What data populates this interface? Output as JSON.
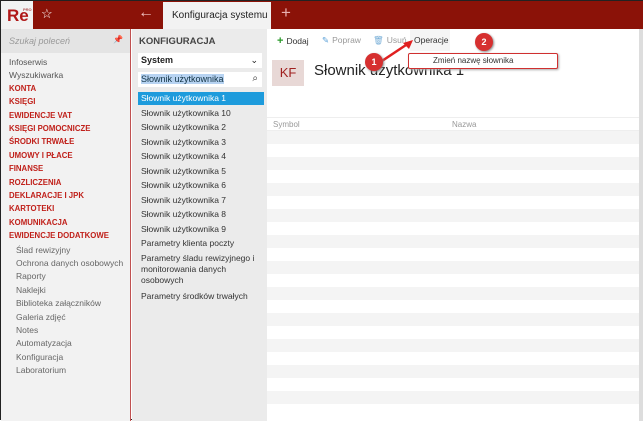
{
  "app": {
    "logo": "Re",
    "logo_sup": "PRO",
    "tab": "Konfiguracja systemu"
  },
  "sidebar": {
    "search_placeholder": "Szukaj poleceń",
    "items": [
      {
        "label": "Infoserwis",
        "type": "plain"
      },
      {
        "label": "Wyszukiwarka",
        "type": "plain"
      },
      {
        "label": "KONTA",
        "type": "cat"
      },
      {
        "label": "KSIĘGI",
        "type": "cat"
      },
      {
        "label": "EWIDENCJE VAT",
        "type": "cat"
      },
      {
        "label": "KSIĘGI POMOCNICZE",
        "type": "cat"
      },
      {
        "label": "ŚRODKI TRWAŁE",
        "type": "cat"
      },
      {
        "label": "UMOWY I PŁACE",
        "type": "cat"
      },
      {
        "label": "FINANSE",
        "type": "cat"
      },
      {
        "label": "ROZLICZENIA",
        "type": "cat"
      },
      {
        "label": "DEKLARACJE I JPK",
        "type": "cat"
      },
      {
        "label": "KARTOTEKI",
        "type": "cat"
      },
      {
        "label": "KOMUNIKACJA",
        "type": "cat"
      },
      {
        "label": "EWIDENCJE DODATKOWE",
        "type": "cat"
      },
      {
        "label": "Ślad rewizyjny",
        "type": "sub"
      },
      {
        "label": "Ochrona danych osobowych",
        "type": "sub"
      },
      {
        "label": "Raporty",
        "type": "sub"
      },
      {
        "label": "Naklejki",
        "type": "sub"
      },
      {
        "label": "Biblioteka załączników",
        "type": "sub"
      },
      {
        "label": "Galeria zdjęć",
        "type": "sub"
      },
      {
        "label": "Notes",
        "type": "sub"
      },
      {
        "label": "Automatyzacja",
        "type": "sub"
      },
      {
        "label": "Konfiguracja",
        "type": "sub"
      },
      {
        "label": "Laboratorium",
        "type": "sub"
      }
    ]
  },
  "middle": {
    "heading": "KONFIGURACJA",
    "select": "System",
    "search_value": "Słownik użytkownika",
    "items": [
      "Słownik użytkownika 1",
      "Słownik użytkownika 10",
      "Słownik użytkownika 2",
      "Słownik użytkownika 3",
      "Słownik użytkownika 4",
      "Słownik użytkownika 5",
      "Słownik użytkownika 6",
      "Słownik użytkownika 7",
      "Słownik użytkownika 8",
      "Słownik użytkownika 9",
      "Parametry klienta poczty",
      "Parametry śladu rewizyjnego i monitorowania danych osobowych",
      "Parametry środków trwałych"
    ],
    "selected": 0
  },
  "toolbar": {
    "add": "Dodaj",
    "edit": "Popraw",
    "delete": "Usuń",
    "operations": "Operacje",
    "menu_item": "Zmień nazwę słownika"
  },
  "badges": [
    "1",
    "2"
  ],
  "content": {
    "badge": "KF",
    "title": "Słownik użytkownika 1",
    "columns": [
      "Symbol",
      "Nazwa"
    ]
  },
  "colors": {
    "brand": "#8b1208",
    "accent": "#c0201a",
    "selected": "#1d9bdc"
  }
}
